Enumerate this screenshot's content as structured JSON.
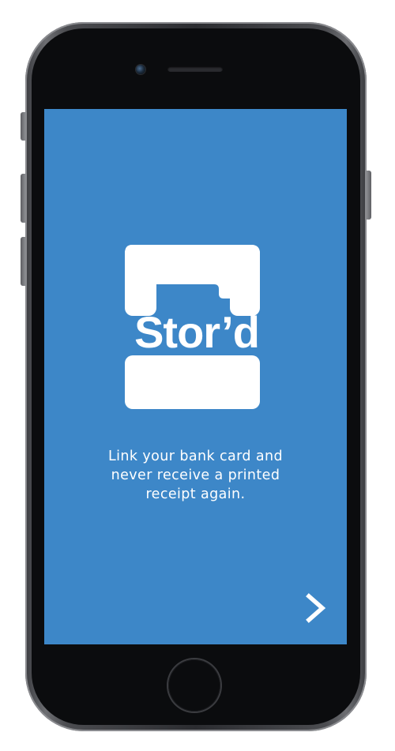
{
  "app": {
    "name": "Stor’d"
  },
  "colors": {
    "screen_background": "#3d87c8",
    "foreground": "#ffffff"
  },
  "onboarding": {
    "logo_text": "Stor’d",
    "tagline_lines": [
      "Link your bank card and",
      "never receive a printed",
      "receipt again."
    ],
    "next_icon": "chevron-right-icon"
  },
  "device": {
    "model_icon": "smartphone",
    "home_button_icon": "home-button"
  }
}
